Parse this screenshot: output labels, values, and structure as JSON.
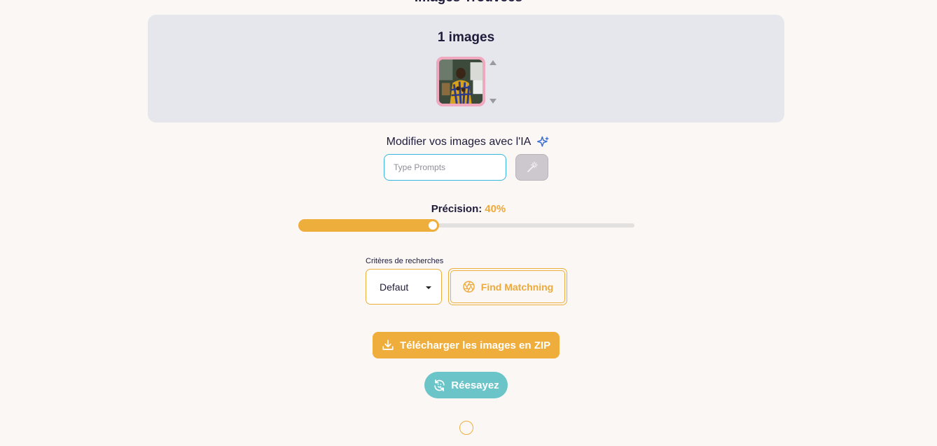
{
  "header": {
    "title": "Images Trouvées"
  },
  "gallery": {
    "count_label": "1 images"
  },
  "ai_editor": {
    "label": "Modifier vos images avec l'IA",
    "prompt_placeholder": "Type Prompts",
    "prompt_value": ""
  },
  "precision": {
    "label": "Précision:",
    "value_label": "40%",
    "value": 40
  },
  "criteria": {
    "label": "Critères de recherches",
    "selected": "Defaut"
  },
  "actions": {
    "find_label": "Find Matchning",
    "zip_label": "Télécharger les images en ZIP",
    "retry_label": "Réesayez"
  },
  "colors": {
    "accent": "#eeae3c",
    "teal": "#6ac4c8",
    "input_border": "#38b6e0",
    "thumb_border": "#f0a8bf"
  }
}
